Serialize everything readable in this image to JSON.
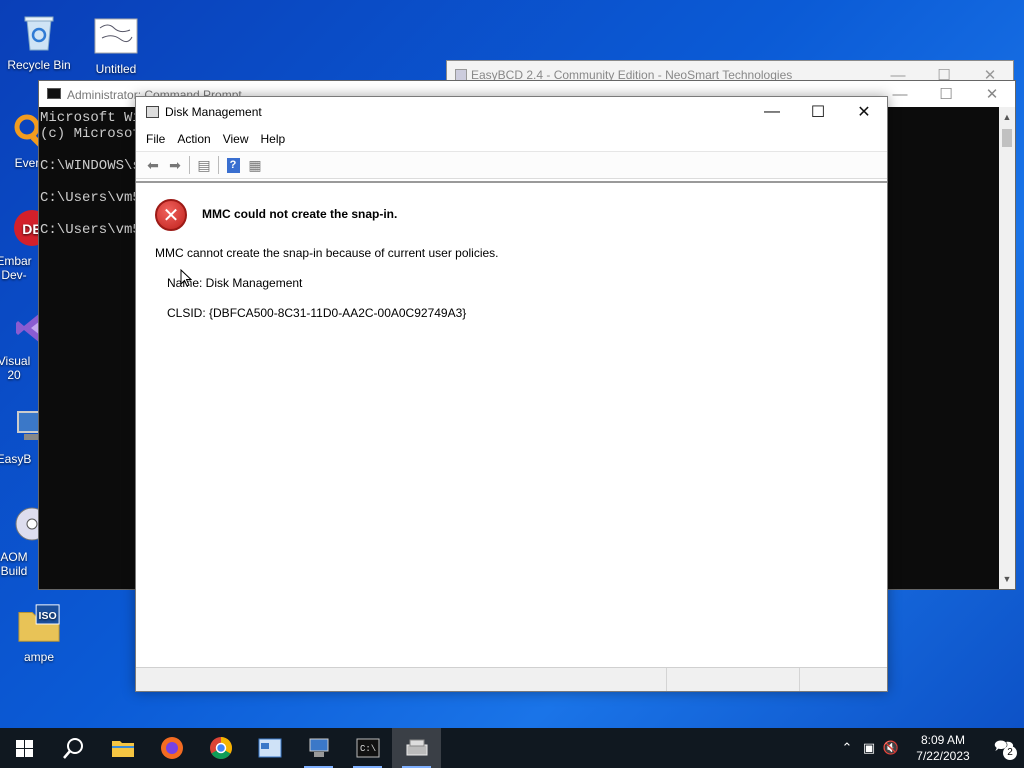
{
  "desktop": {
    "icons": [
      {
        "label": "Recycle Bin",
        "icon": "recycle-bin-icon"
      },
      {
        "label": "Untitled",
        "icon": "image-file-icon"
      },
      {
        "label": "Every",
        "icon": "everything-search-icon"
      },
      {
        "label": "Embar Dev-",
        "icon": "embarcadero-icon"
      },
      {
        "label": "Visual 20",
        "icon": "visual-studio-icon"
      },
      {
        "label": "EasyB",
        "icon": "easybcd-icon"
      },
      {
        "label": "AOM Build",
        "icon": "aomei-icon"
      },
      {
        "label": "ampe",
        "icon": "iso-file-icon"
      }
    ]
  },
  "easybcd_window": {
    "title": "EasyBCD 2.4 - Community Edition - NeoSmart Technologies"
  },
  "cmd_window": {
    "title": "Administrator: Command Prompt",
    "lines": "Microsoft Wi\n(c) Microsof\n\nC:\\WINDOWS\\s\n\nC:\\Users\\vm5\n\nC:\\Users\\vm5"
  },
  "disk_management": {
    "title": "Disk Management",
    "menu": [
      "File",
      "Action",
      "View",
      "Help"
    ],
    "error_title": "MMC could not create the snap-in.",
    "error_message": "MMC cannot create the snap-in because of current user policies.",
    "name_line": "Name: Disk Management",
    "clsid_line": "CLSID: {DBFCA500-8C31-11D0-AA2C-00A0C92749A3}"
  },
  "taskbar": {
    "time": "8:09 AM",
    "date": "7/22/2023",
    "notification_count": "2"
  }
}
